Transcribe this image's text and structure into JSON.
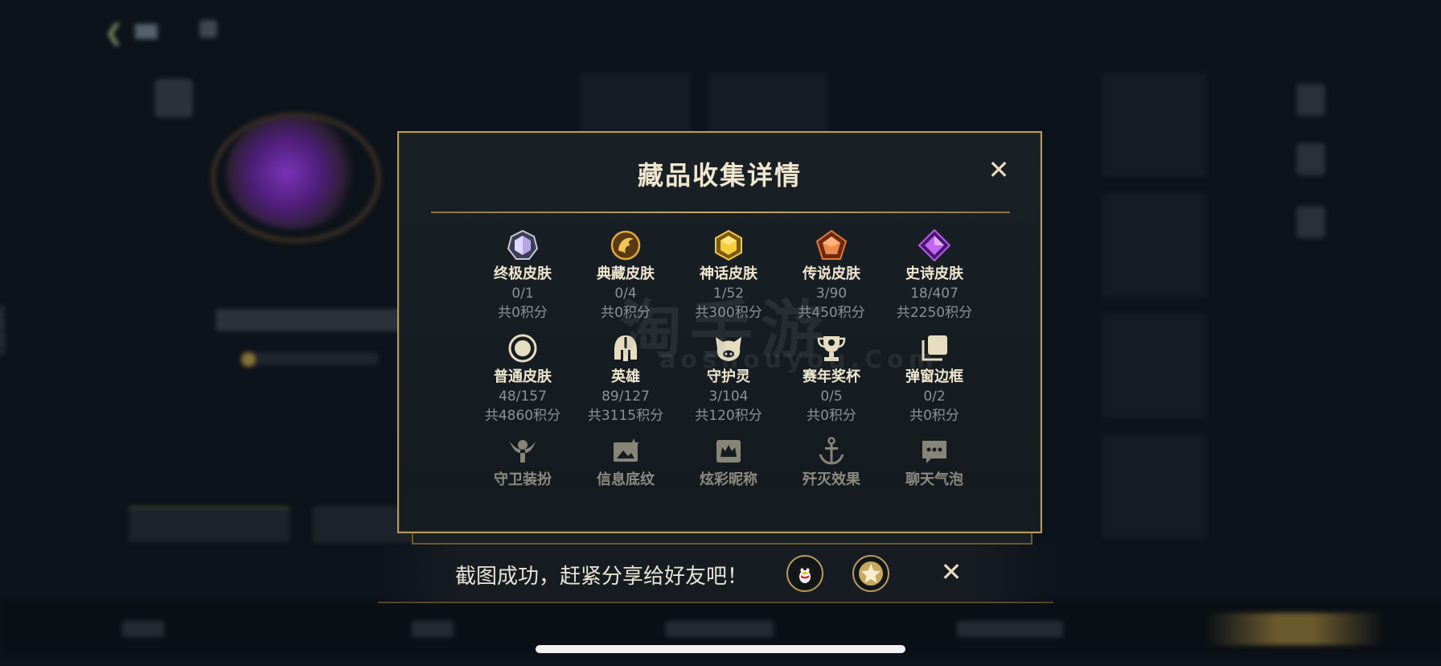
{
  "modal": {
    "title": "藏品收集详情",
    "close_label": "✕"
  },
  "collections": [
    {
      "icon": "ultimate-skin-icon",
      "name": "终极皮肤",
      "count": "0/1",
      "points": "共0积分"
    },
    {
      "icon": "treasure-skin-icon",
      "name": "典藏皮肤",
      "count": "0/4",
      "points": "共0积分"
    },
    {
      "icon": "mythic-skin-icon",
      "name": "神话皮肤",
      "count": "1/52",
      "points": "共300积分"
    },
    {
      "icon": "legendary-skin-icon",
      "name": "传说皮肤",
      "count": "3/90",
      "points": "共450积分"
    },
    {
      "icon": "epic-skin-icon",
      "name": "史诗皮肤",
      "count": "18/407",
      "points": "共2250积分"
    },
    {
      "icon": "normal-skin-icon",
      "name": "普通皮肤",
      "count": "48/157",
      "points": "共4860积分"
    },
    {
      "icon": "hero-helmet-icon",
      "name": "英雄",
      "count": "89/127",
      "points": "共3115积分"
    },
    {
      "icon": "guardian-spirit-icon",
      "name": "守护灵",
      "count": "3/104",
      "points": "共120积分"
    },
    {
      "icon": "season-trophy-icon",
      "name": "赛年奖杯",
      "count": "0/5",
      "points": "共0积分"
    },
    {
      "icon": "popup-frame-icon",
      "name": "弹窗边框",
      "count": "0/2",
      "points": "共0积分"
    },
    {
      "icon": "ward-skin-icon",
      "name": "守卫装扮"
    },
    {
      "icon": "info-pattern-icon",
      "name": "信息底纹"
    },
    {
      "icon": "colorful-nickname-icon",
      "name": "炫彩昵称"
    },
    {
      "icon": "annihilation-effect-icon",
      "name": "歼灭效果"
    },
    {
      "icon": "chat-bubble-icon",
      "name": "聊天气泡"
    }
  ],
  "watermark": {
    "text": "淘手游",
    "sub": "aoshouyou.Com"
  },
  "share": {
    "text": "截图成功，赶紧分享给好友吧！",
    "close_label": "✕"
  },
  "background": {
    "side_id": "54463653"
  },
  "colors": {
    "gold": "#b89a5c",
    "panel": "#161d22",
    "title_text": "#efe6cf",
    "muted_text": "#8d9196"
  }
}
